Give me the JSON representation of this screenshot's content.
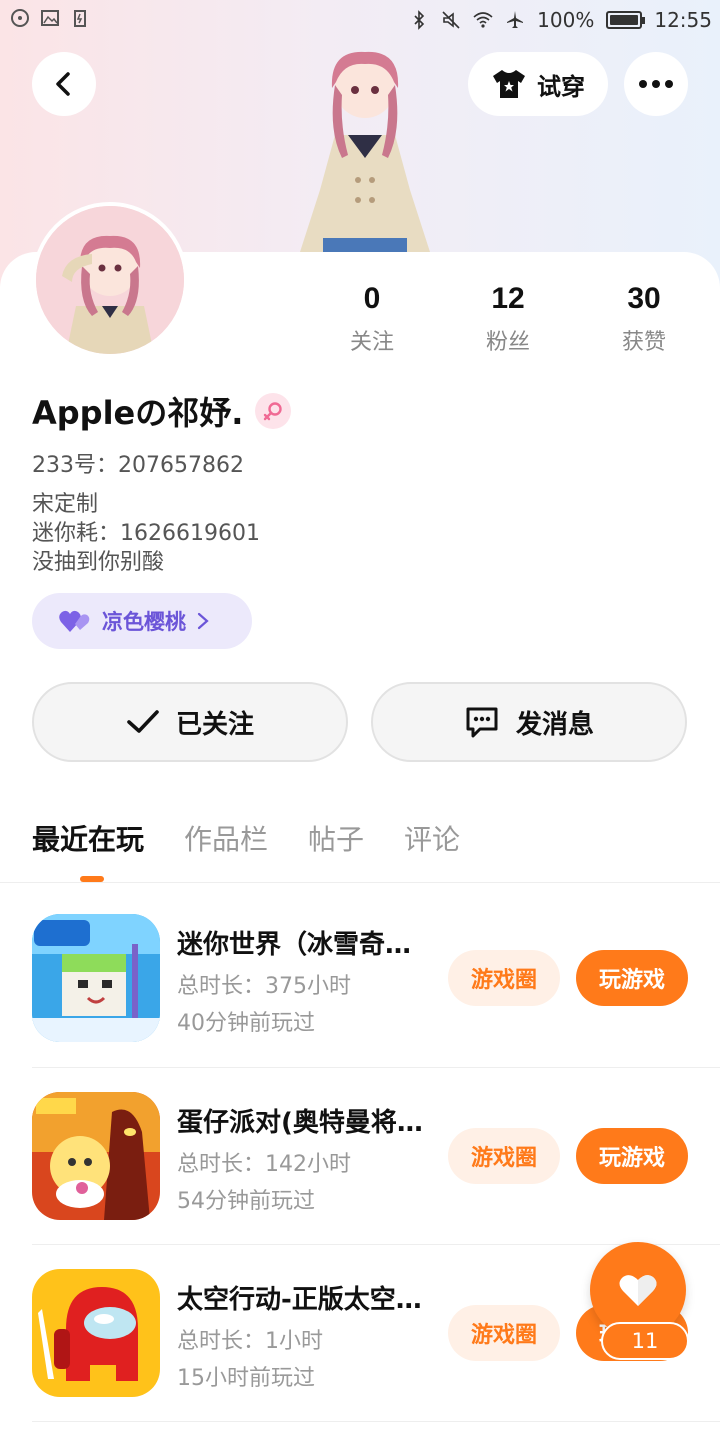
{
  "status_bar": {
    "battery": "100%",
    "time": "12:55"
  },
  "header": {
    "try_on_label": "试穿"
  },
  "profile": {
    "stats": [
      {
        "value": "0",
        "label": "关注"
      },
      {
        "value": "12",
        "label": "粉丝"
      },
      {
        "value": "30",
        "label": "获赞"
      }
    ],
    "name": "Appleの祁妤.",
    "uid": "233号：207657862",
    "bio": [
      "宋定制",
      "迷你耗：1626619601",
      "没抽到你别酸"
    ],
    "tag": "凉色樱桃"
  },
  "actions": {
    "follow_label": "已关注",
    "message_label": "发消息"
  },
  "tabs": [
    "最近在玩",
    "作品栏",
    "帖子",
    "评论"
  ],
  "games": [
    {
      "title": "迷你世界（冰雪奇…",
      "duration": "总时长：375小时",
      "last_played": "40分钟前玩过",
      "circle_label": "游戏圈",
      "play_label": "玩游戏"
    },
    {
      "title": "蛋仔派对(奥特曼将…",
      "duration": "总时长：142小时",
      "last_played": "54分钟前玩过",
      "circle_label": "游戏圈",
      "play_label": "玩游戏"
    },
    {
      "title": "太空行动-正版太空…",
      "duration": "总时长：1小时",
      "last_played": "15小时前玩过",
      "circle_label": "游戏圈",
      "play_label": "玩游戏"
    }
  ],
  "like_fab": {
    "count": "11"
  },
  "colors": {
    "accent": "#ff7a1a",
    "tag_purple": "#6b55d8"
  }
}
